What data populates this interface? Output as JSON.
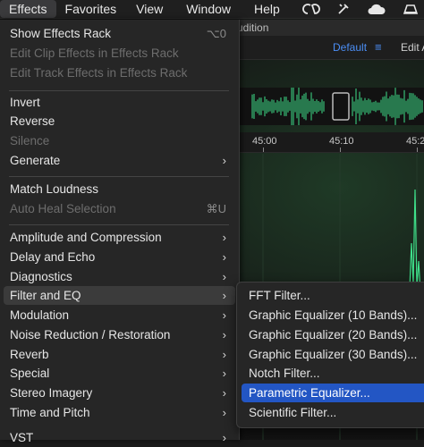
{
  "menubar": {
    "items": [
      "Effects",
      "Favorites",
      "View",
      "Window",
      "Help"
    ],
    "active_index": 0,
    "status_icons": [
      "creative-cloud-icon",
      "script-editor-icon",
      "icloud-icon",
      "dock-icon"
    ]
  },
  "app": {
    "title_fragment": "udition",
    "workspace_label": "Default",
    "workspace_menu_glyph": "≡",
    "workspace_next": "Edit A",
    "ruler_ticks": [
      "45:00",
      "45:10",
      "45:2"
    ],
    "accent_color": "#4b8ef5",
    "waveform_color": "#3fe08a"
  },
  "effects_menu": {
    "items": [
      {
        "label": "Show Effects Rack",
        "shortcut": "⌥0",
        "enabled": true
      },
      {
        "label": "Edit Clip Effects in Effects Rack",
        "enabled": false
      },
      {
        "label": "Edit Track Effects in Effects Rack",
        "enabled": false
      },
      {
        "label": "Invert",
        "enabled": true
      },
      {
        "label": "Reverse",
        "enabled": true
      },
      {
        "label": "Silence",
        "enabled": false
      },
      {
        "label": "Generate",
        "submenu": true,
        "enabled": true
      },
      {
        "label": "Match Loudness",
        "enabled": true
      },
      {
        "label": "Auto Heal Selection",
        "shortcut": "⌘U",
        "enabled": false
      },
      {
        "label": "Amplitude and Compression",
        "submenu": true,
        "enabled": true
      },
      {
        "label": "Delay and Echo",
        "submenu": true,
        "enabled": true
      },
      {
        "label": "Diagnostics",
        "submenu": true,
        "enabled": true
      },
      {
        "label": "Filter and EQ",
        "submenu": true,
        "enabled": true,
        "highlighted": true
      },
      {
        "label": "Modulation",
        "submenu": true,
        "enabled": true
      },
      {
        "label": "Noise Reduction / Restoration",
        "submenu": true,
        "enabled": true
      },
      {
        "label": "Reverb",
        "submenu": true,
        "enabled": true
      },
      {
        "label": "Special",
        "submenu": true,
        "enabled": true
      },
      {
        "label": "Stereo Imagery",
        "submenu": true,
        "enabled": true
      },
      {
        "label": "Time and Pitch",
        "submenu": true,
        "enabled": true
      },
      {
        "label": "VST",
        "submenu": true,
        "enabled": true
      }
    ],
    "submenu_arrow": "›"
  },
  "filter_eq_submenu": {
    "items": [
      "FFT Filter...",
      "Graphic Equalizer (10 Bands)...",
      "Graphic Equalizer (20 Bands)...",
      "Graphic Equalizer (30 Bands)...",
      "Notch Filter...",
      "Parametric Equalizer...",
      "Scientific Filter..."
    ],
    "selected_index": 5,
    "selection_color": "#2356c4"
  }
}
